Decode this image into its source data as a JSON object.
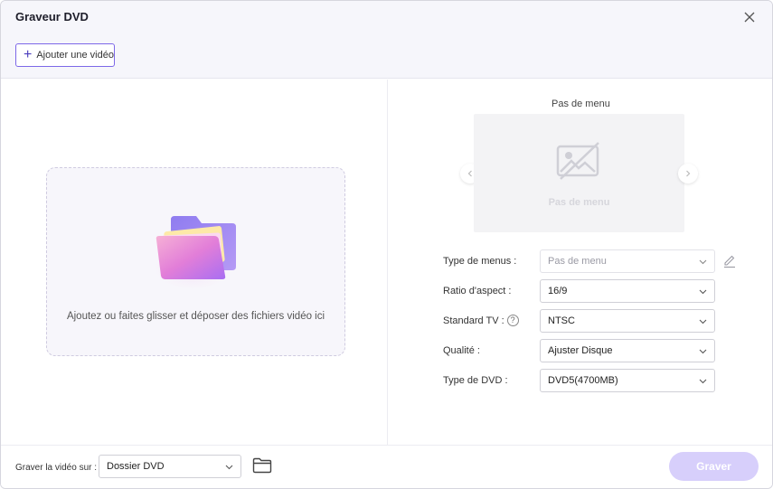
{
  "window": {
    "title": "Graveur DVD"
  },
  "toolbar": {
    "add_video_label": "Ajouter une vidéo"
  },
  "dropzone": {
    "text": "Ajoutez ou faites glisser et déposer des fichiers vidéo ici"
  },
  "menu_preview": {
    "title": "Pas de menu",
    "placeholder_text": "Pas de menu"
  },
  "settings": {
    "menu_type": {
      "label": "Type de menus :",
      "value": "Pas de menu"
    },
    "aspect_ratio": {
      "label": "Ratio d'aspect :",
      "value": "16/9"
    },
    "tv_standard": {
      "label": "Standard TV :",
      "value": "NTSC"
    },
    "quality": {
      "label": "Qualité :",
      "value": "Ajuster Disque"
    },
    "dvd_type": {
      "label": "Type de DVD :",
      "value": "DVD5(4700MB)"
    }
  },
  "footer": {
    "burn_to_label": "Graver la vidéo sur :",
    "destination": "Dossier DVD",
    "burn_button": "Graver"
  },
  "colors": {
    "accent": "#7d68e8",
    "burn_button_disabled": "#d7cffb",
    "header_bg": "#f6f6fb"
  }
}
